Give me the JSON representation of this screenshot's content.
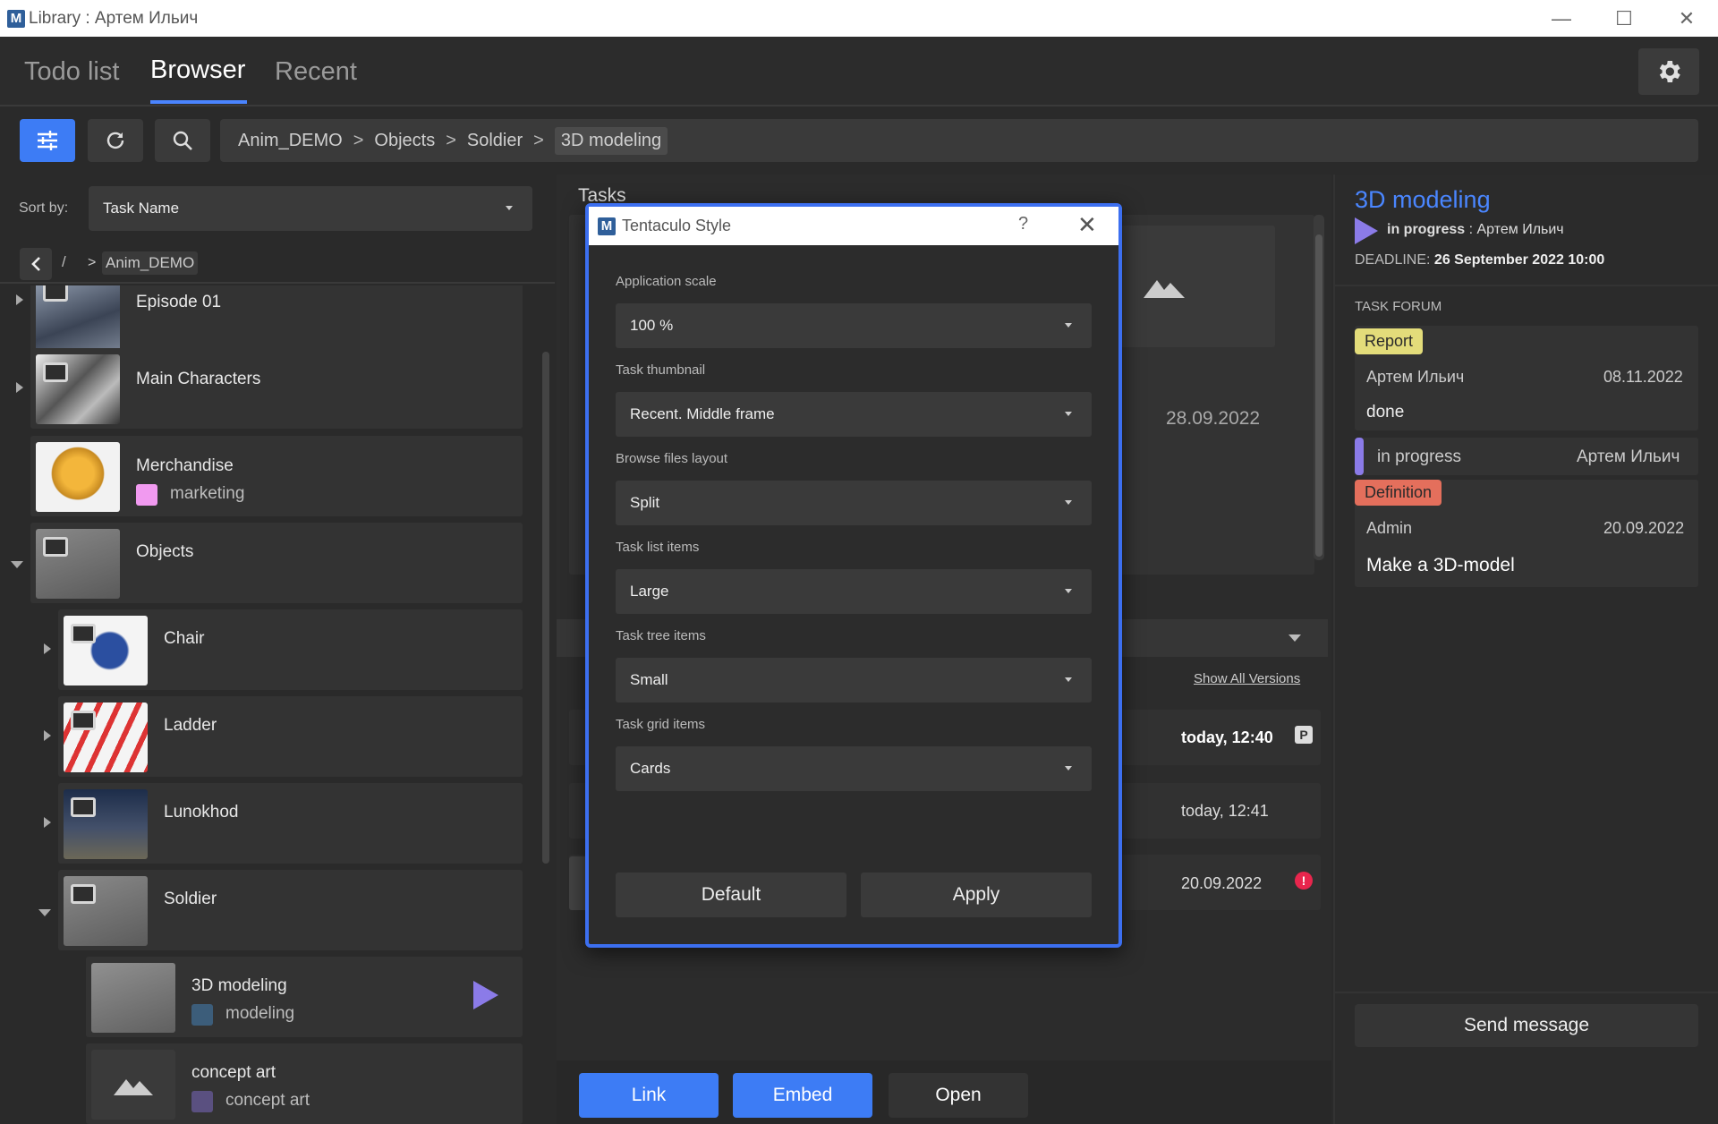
{
  "window": {
    "title": "Library : Артем Ильич",
    "logo_letter": "M"
  },
  "nav": {
    "tabs": [
      "Todo list",
      "Browser",
      "Recent"
    ]
  },
  "path": {
    "items": [
      "Anim_DEMO",
      "Objects",
      "Soldier",
      "3D modeling"
    ],
    "separator": ">"
  },
  "sort": {
    "label": "Sort by:",
    "value": "Task Name"
  },
  "breadcrumb": {
    "slash": "/",
    "gt": ">",
    "root": "Anim_DEMO"
  },
  "tree": [
    {
      "label": "Episode 01"
    },
    {
      "label": "Main Characters"
    },
    {
      "label": "Merchandise",
      "tag": "marketing",
      "tag_color": "#f19af0"
    },
    {
      "label": "Objects"
    },
    {
      "label": "Chair"
    },
    {
      "label": "Ladder"
    },
    {
      "label": "Lunokhod"
    },
    {
      "label": "Soldier"
    },
    {
      "label": "3D modeling",
      "tag": "modeling",
      "tag_color": "#3c5d7a"
    },
    {
      "label": "concept art",
      "tag": "concept art",
      "tag_color": "#5a5080"
    }
  ],
  "middle": {
    "header": "Tasks",
    "date": "28.09.2022",
    "show_all": "Show All Versions",
    "versions": [
      {
        "date": "today, 12:40",
        "badge": "P"
      },
      {
        "date": "today, 12:41"
      },
      {
        "date": "20.09.2022",
        "badge": "!"
      }
    ]
  },
  "bottom": {
    "link": "Link",
    "embed": "Embed",
    "open": "Open"
  },
  "right": {
    "title": "3D modeling",
    "status": "in progress",
    "assignee": ": Артем Ильич",
    "deadline_label": "DEADLINE:",
    "deadline": "26 September 2022 10:00",
    "forum_label": "TASK FORUM",
    "posts": [
      {
        "badge": "Report",
        "author": "Артем Ильич",
        "date": "08.11.2022",
        "text": "done"
      },
      {
        "status": "in progress",
        "author": "Артем Ильич"
      },
      {
        "badge": "Definition",
        "author": "Admin",
        "date": "20.09.2022",
        "text": "Make a 3D-model"
      }
    ],
    "send": "Send message"
  },
  "dialog": {
    "title": "Tentaculo Style",
    "help": "?",
    "fields": [
      {
        "label": "Application scale",
        "value": "100 %"
      },
      {
        "label": "Task thumbnail",
        "value": "Recent. Middle frame"
      },
      {
        "label": "Browse files layout",
        "value": "Split"
      },
      {
        "label": "Task list items",
        "value": "Large"
      },
      {
        "label": "Task tree items",
        "value": "Small"
      },
      {
        "label": "Task grid items",
        "value": "Cards"
      }
    ],
    "default_btn": "Default",
    "apply_btn": "Apply"
  },
  "colors": {
    "accent": "#3d7cf5",
    "title_blue": "#4a86ff",
    "report": "#e3dc7a",
    "definition": "#e46f5c",
    "progress": "#8b7be8",
    "error": "#e8264d"
  },
  "icons": [
    "filter-icon",
    "refresh-icon",
    "search-icon",
    "gear-icon",
    "play-icon",
    "folder-icon",
    "image-placeholder-icon",
    "chevron-left-icon",
    "chevron-down-icon",
    "close-icon"
  ]
}
